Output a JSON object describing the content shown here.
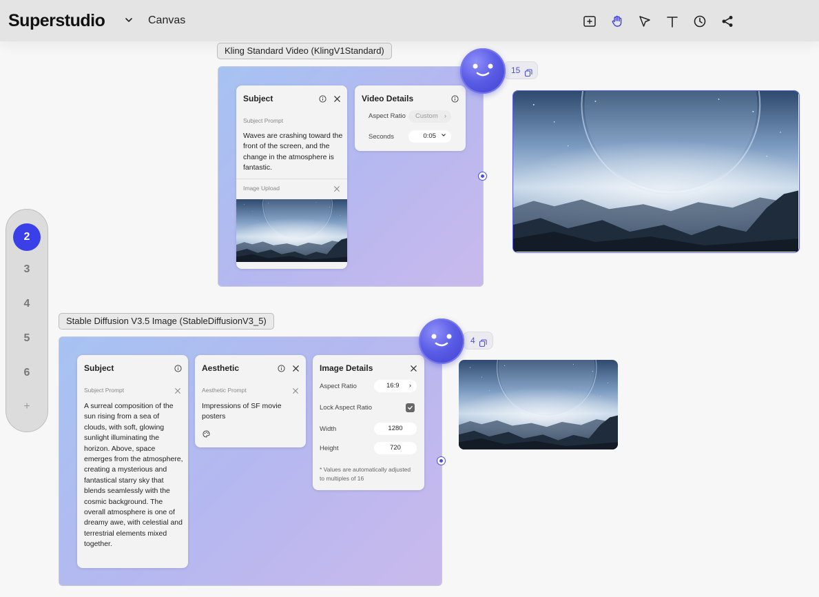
{
  "header": {
    "brand": "Superstudio",
    "page": "Canvas",
    "tools": [
      "add-frame-icon",
      "hand-icon",
      "pointer-icon",
      "text-icon",
      "history-icon",
      "share-icon"
    ],
    "active_tool": "hand-icon"
  },
  "colors": {
    "accent": "#3b3fe8",
    "node_gradient_start": "#a6c3f2",
    "node_gradient_end": "#c9b9ec",
    "topbar_bg": "#e4e4e4",
    "canvas_bg": "#f7f7f7"
  },
  "pager": {
    "pages": [
      "2",
      "3",
      "4",
      "5",
      "6"
    ],
    "active": "2",
    "add": "+"
  },
  "video_node": {
    "tag": "Kling Standard Video (KlingV1Standard)",
    "credits": "15",
    "subject": {
      "title": "Subject",
      "prompt_label": "Subject Prompt",
      "prompt": "Waves are crashing toward the front of the screen, and the change in the atmosphere is fantastic.",
      "upload_label": "Image Upload"
    },
    "details": {
      "title": "Video Details",
      "aspect_label": "Aspect Ratio",
      "aspect_value": "Custom",
      "seconds_label": "Seconds",
      "seconds_value": "0:05"
    }
  },
  "image_node": {
    "tag": "Stable Diffusion V3.5 Image (StableDiffusionV3_5)",
    "credits": "4",
    "subject": {
      "title": "Subject",
      "prompt_label": "Subject Prompt",
      "prompt": "A surreal composition of the sun rising from a sea of clouds, with soft, glowing sunlight illuminating the horizon. Above, space emerges from the atmosphere, creating a mysterious and fantastical starry sky that blends seamlessly with the cosmic background. The overall atmosphere is one of dreamy awe, with celestial and terrestrial elements mixed together."
    },
    "aesthetic": {
      "title": "Aesthetic",
      "prompt_label": "Aesthetic Prompt",
      "prompt": "Impressions of SF movie posters"
    },
    "details": {
      "title": "Image Details",
      "aspect_label": "Aspect Ratio",
      "aspect_value": "16:9",
      "lock_label": "Lock Aspect Ratio",
      "lock_checked": true,
      "width_label": "Width",
      "width_value": "1280",
      "height_label": "Height",
      "height_value": "720",
      "note": "* Values are automatically adjusted to multiples of 16"
    }
  }
}
